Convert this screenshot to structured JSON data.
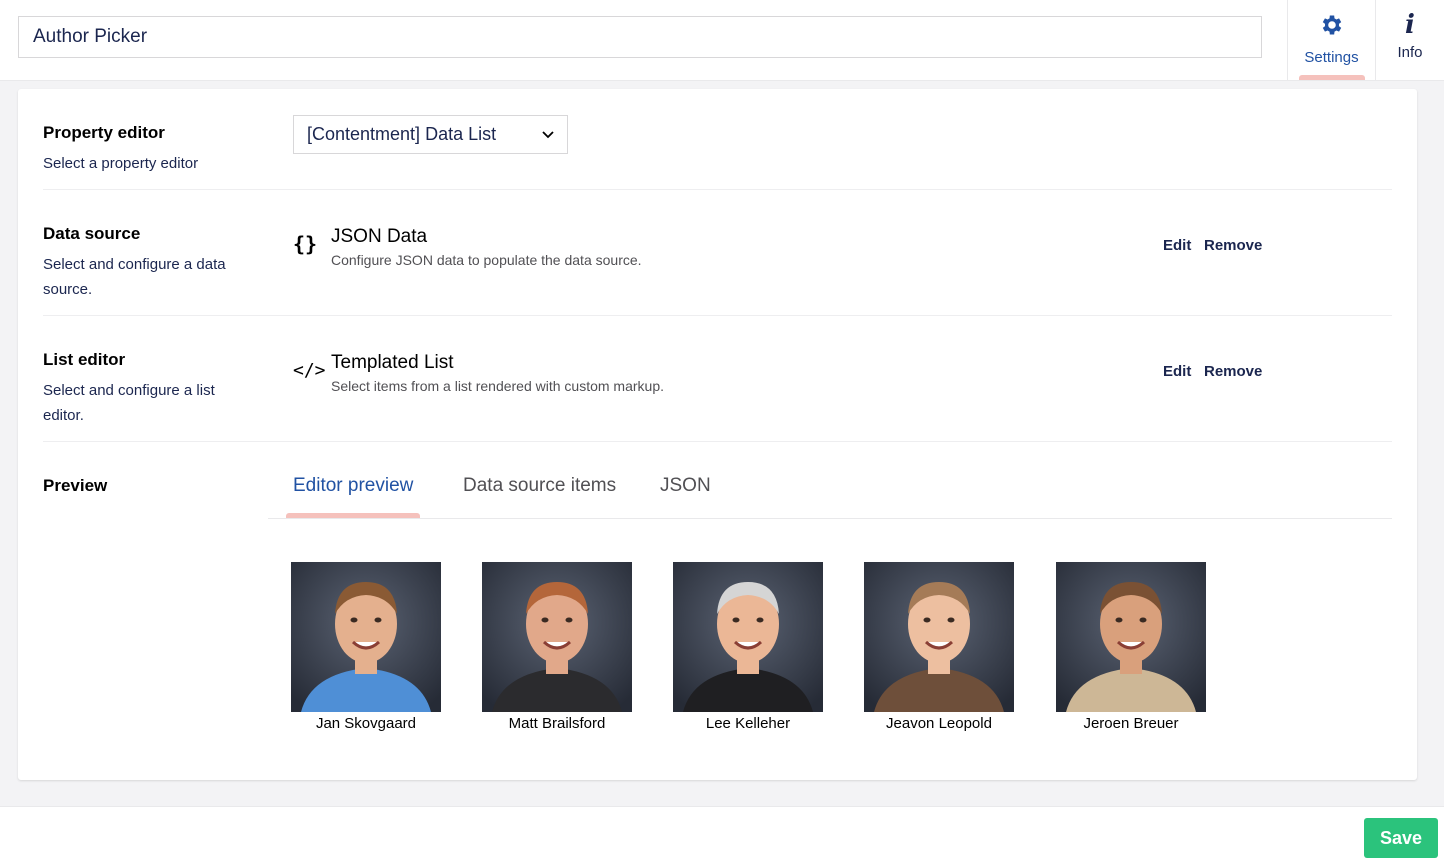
{
  "header": {
    "name_value": "Author Picker",
    "apps": [
      {
        "label": "Settings",
        "icon": "gear-icon",
        "active": true
      },
      {
        "label": "Info",
        "icon": "info-icon",
        "active": false
      }
    ]
  },
  "property_editor": {
    "label": "Property editor",
    "description": "Select a property editor",
    "selected": "[Contentment] Data List"
  },
  "data_source": {
    "label": "Data source",
    "description": "Select and configure a data source.",
    "item_icon": "{}",
    "item_title": "JSON Data",
    "item_description": "Configure JSON data to populate the data source.",
    "edit_label": "Edit",
    "remove_label": "Remove"
  },
  "list_editor": {
    "label": "List editor",
    "description": "Select and configure a list editor.",
    "item_icon": "</>",
    "item_title": "Templated List",
    "item_description": "Select items from a list rendered with custom markup.",
    "edit_label": "Edit",
    "remove_label": "Remove"
  },
  "preview": {
    "label": "Preview",
    "tabs": [
      {
        "label": "Editor preview",
        "active": true
      },
      {
        "label": "Data source items",
        "active": false
      },
      {
        "label": "JSON",
        "active": false
      }
    ],
    "people": [
      {
        "name": "Jan Skovgaard",
        "shirt": "#4f8fd6",
        "hair": "#8a5a34",
        "skin": "#e4b08e"
      },
      {
        "name": "Matt Brailsford",
        "shirt": "#2b2b2e",
        "hair": "#b4663a",
        "skin": "#e1a88a"
      },
      {
        "name": "Lee Kelleher",
        "shirt": "#1f1f22",
        "hair": "#d5d5d5",
        "skin": "#ebb796"
      },
      {
        "name": "Jeavon Leopold",
        "shirt": "#6e4f3a",
        "hair": "#a57b57",
        "skin": "#edbfa0"
      },
      {
        "name": "Jeroen Breuer",
        "shirt": "#cdb796",
        "hair": "#7a5134",
        "skin": "#d9a07c"
      }
    ]
  },
  "footer": {
    "save_label": "Save"
  },
  "colors": {
    "accent": "#2152a3",
    "indicator": "#f5c1bc",
    "save": "#2bc37c"
  }
}
